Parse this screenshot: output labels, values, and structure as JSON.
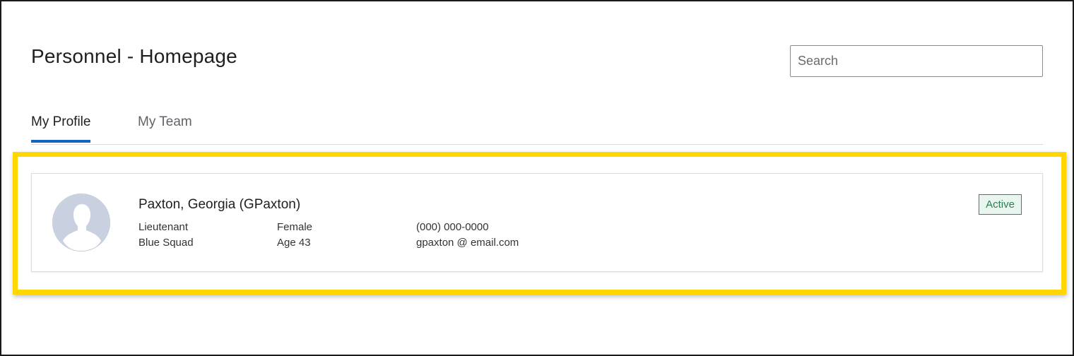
{
  "header": {
    "title": "Personnel - Homepage",
    "search_placeholder": "Search"
  },
  "tabs": [
    {
      "label": "My Profile",
      "active": true
    },
    {
      "label": "My Team",
      "active": false
    }
  ],
  "profile": {
    "name": "Paxton, Georgia (GPaxton)",
    "rank": "Lieutenant",
    "squad": "Blue Squad",
    "gender": "Female",
    "age": "Age 43",
    "phone": "(000) 000-0000",
    "email": "gpaxton @ email.com",
    "status": "Active",
    "avatar_icon": "user-silhouette-icon"
  },
  "colors": {
    "accent_tab": "#1565c0",
    "highlight": "#ffd600",
    "status_green": "#2e8b57"
  }
}
